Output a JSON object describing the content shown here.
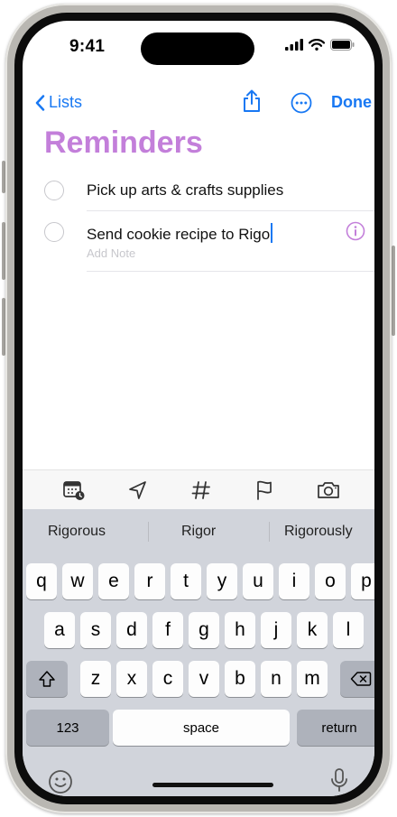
{
  "status": {
    "time": "9:41"
  },
  "nav": {
    "back_label": "Lists",
    "done_label": "Done"
  },
  "list": {
    "title": "Reminders",
    "items": [
      {
        "text": "Pick up arts & crafts supplies"
      },
      {
        "text": "Send cookie recipe to Rigo",
        "note_placeholder": "Add Note"
      }
    ]
  },
  "toolbar": {
    "icons": [
      "calendar-icon",
      "location-icon",
      "tag-icon",
      "flag-icon",
      "camera-icon"
    ]
  },
  "keyboard": {
    "suggestions": [
      "Rigorous",
      "Rigor",
      "Rigorously"
    ],
    "row1": [
      "q",
      "w",
      "e",
      "r",
      "t",
      "y",
      "u",
      "i",
      "o",
      "p"
    ],
    "row2": [
      "a",
      "s",
      "d",
      "f",
      "g",
      "h",
      "j",
      "k",
      "l"
    ],
    "row3": [
      "z",
      "x",
      "c",
      "v",
      "b",
      "n",
      "m"
    ],
    "numbers_label": "123",
    "space_label": "space",
    "return_label": "return"
  },
  "colors": {
    "accent_blue": "#1878f3",
    "title_purple": "#c37fda",
    "keyboard_bg": "#d1d4db"
  }
}
